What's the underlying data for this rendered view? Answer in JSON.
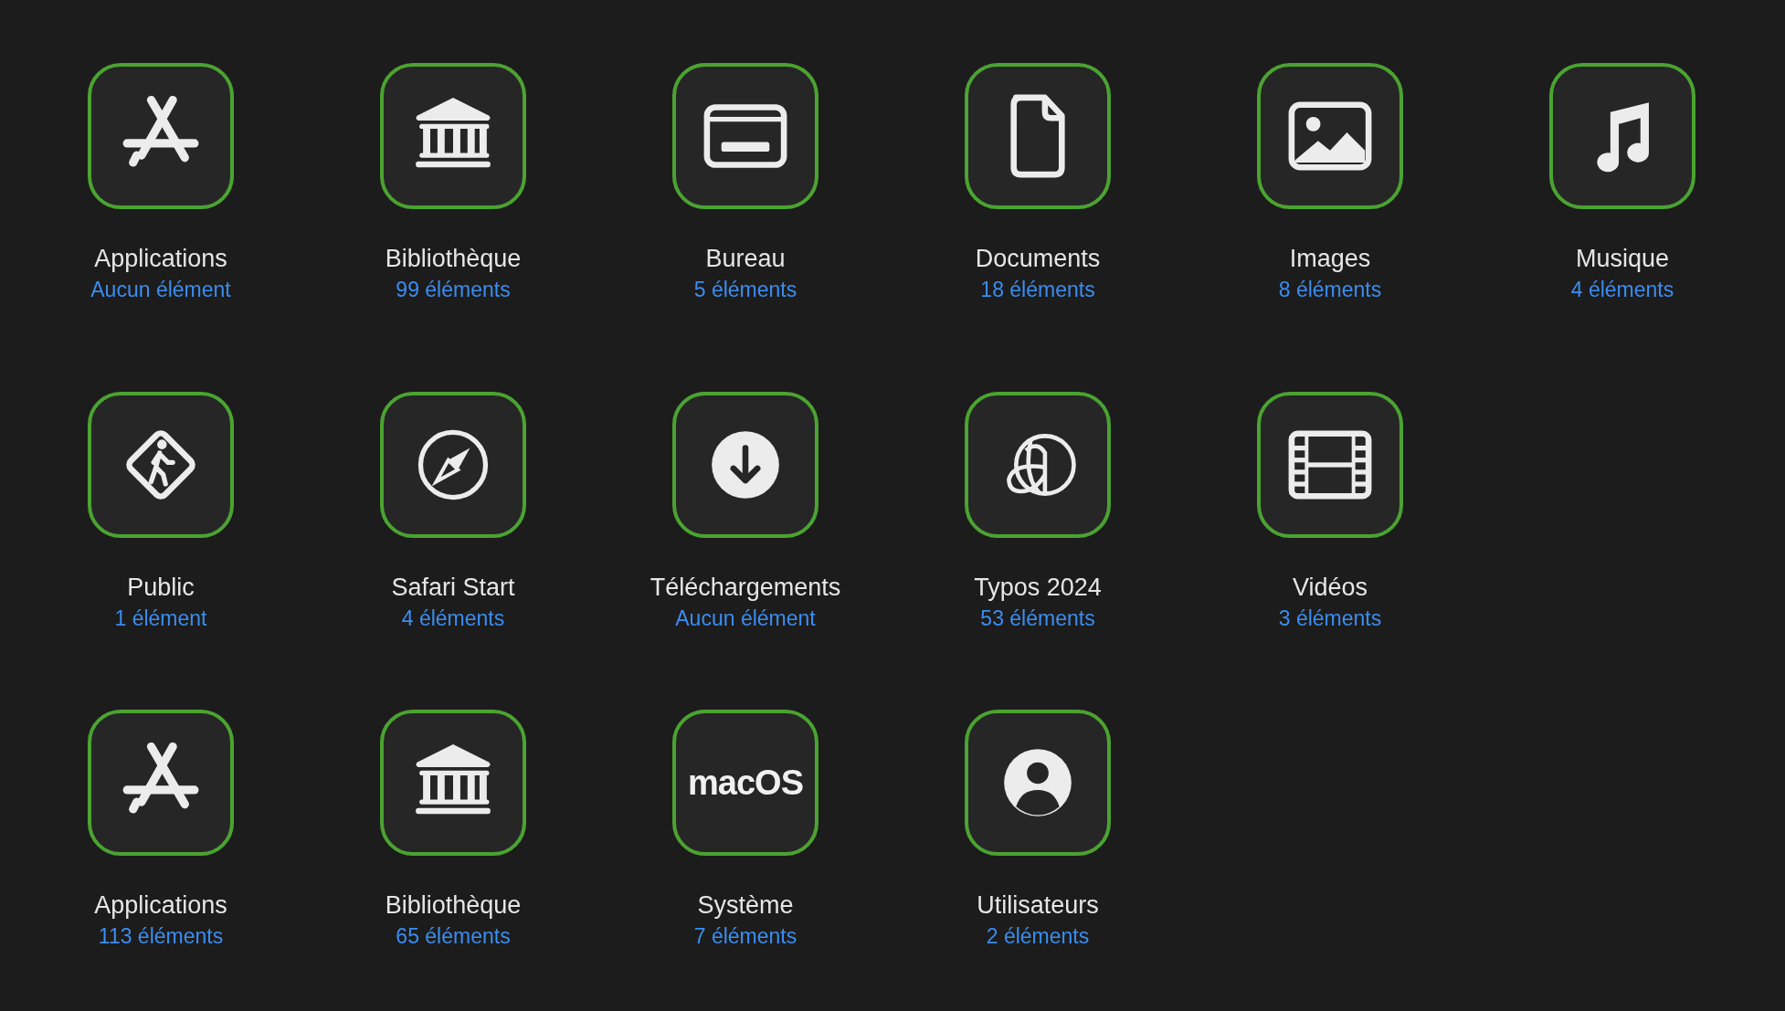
{
  "rows": [
    [
      {
        "title": "Applications",
        "count": "Aucun élément"
      },
      {
        "title": "Bibliothèque",
        "count": "99 éléments"
      },
      {
        "title": "Bureau",
        "count": "5 éléments"
      },
      {
        "title": "Documents",
        "count": "18 éléments"
      },
      {
        "title": "Images",
        "count": "8 éléments"
      },
      {
        "title": "Musique",
        "count": "4 éléments"
      }
    ],
    [
      {
        "title": "Public",
        "count": "1 élément"
      },
      {
        "title": "Safari Start",
        "count": "4 éléments"
      },
      {
        "title": "Téléchargements",
        "count": "Aucun élément"
      },
      {
        "title": "Typos 2024",
        "count": "53 éléments"
      },
      {
        "title": "Vidéos",
        "count": "3 éléments"
      }
    ],
    [
      {
        "title": "Applications",
        "count": "113 éléments"
      },
      {
        "title": "Bibliothèque",
        "count": "65 éléments"
      },
      {
        "title": "Système",
        "count": "7 éléments",
        "tile_text": "macOS"
      },
      {
        "title": "Utilisateurs",
        "count": "2 éléments"
      }
    ]
  ]
}
